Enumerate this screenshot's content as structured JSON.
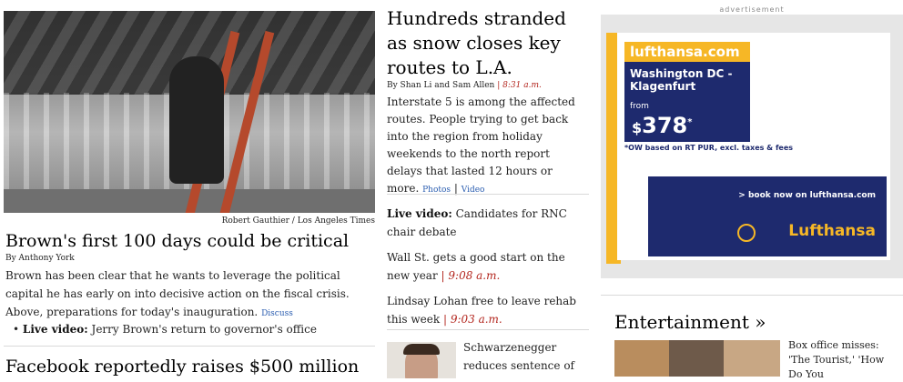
{
  "left": {
    "photo_credit": "Robert Gauthier / Los Angeles Times",
    "headline": "Brown's first 100 days could be critical",
    "byline": "By Anthony York",
    "summary": "Brown has been clear that he wants to leverage the political capital he has early on into decisive action on the fiscal crisis. Above, preparations for today's inauguration.",
    "summary_link": "Discuss",
    "bullet_label": "Live video:",
    "bullet_text": "Jerry Brown's return to governor's office",
    "next_headline": "Facebook reportedly raises $500 million"
  },
  "middle": {
    "headline": "Hundreds stranded as snow closes key routes to L.A.",
    "byline": "By Shan Li and Sam Allen",
    "byline_time": "8:31 a.m.",
    "summary": "Interstate 5 is among the affected routes. People trying to get back into the region from holiday weekends to the north report delays that lasted 12 hours or more.",
    "link_photos": "Photos",
    "link_video": "Video",
    "item1_label": "Live video:",
    "item1_text": "Candidates for RNC chair debate",
    "item2_text": "Wall St. gets a good start on the new year",
    "item2_time": "9:08 a.m.",
    "item3_text": "Lindsay Lohan free to leave rehab this week",
    "item3_time": "9:03 a.m.",
    "thumb_text": "Schwarzenegger reduces sentence of"
  },
  "ad": {
    "label": "advertisement",
    "logo": "lufthansa.com",
    "route": "Washington DC - Klagenfurt",
    "from": "from",
    "currency": "$",
    "price": "378",
    "asterisk": "*",
    "note": "*OW based on RT PUR, excl. taxes & fees",
    "book": "> book now on lufthansa.com",
    "brand": "Lufthansa"
  },
  "entertainment": {
    "heading": "Entertainment »",
    "story": "Box office misses: 'The Tourist,' 'How Do You"
  }
}
